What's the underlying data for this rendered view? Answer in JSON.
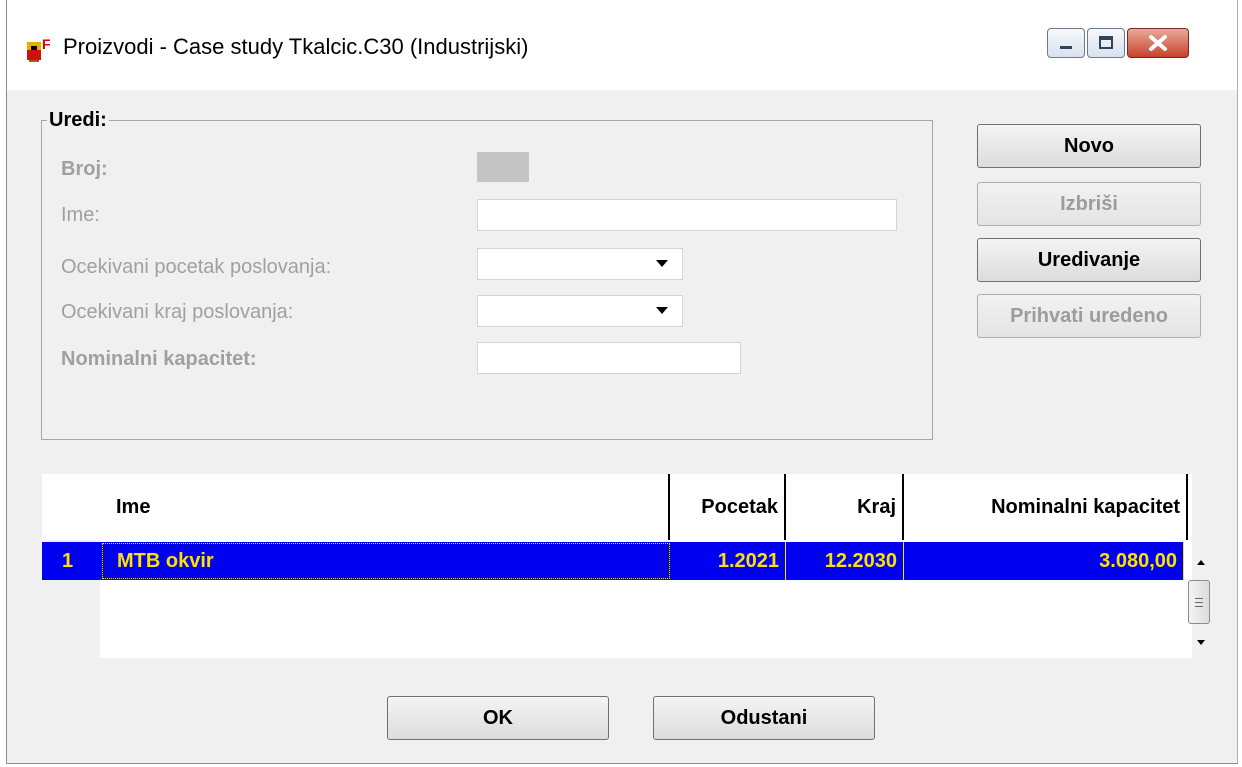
{
  "window": {
    "title": "Proizvodi - Case study Tkalcic.C30 (Industrijski)",
    "app_icon": "app-logo-icon",
    "controls": [
      "minimize-icon",
      "maximize-icon",
      "close-icon"
    ]
  },
  "form": {
    "group_label": "Uredi:",
    "fields": {
      "broj": {
        "label": "Broj:",
        "value": ""
      },
      "ime": {
        "label": "Ime:",
        "value": ""
      },
      "pocetak": {
        "label": "Ocekivani pocetak poslovanja:",
        "value": ""
      },
      "kraj": {
        "label": "Ocekivani kraj poslovanja:",
        "value": ""
      },
      "kapacitet": {
        "label": "Nominalni kapacitet:",
        "value": ""
      }
    }
  },
  "actions": {
    "novo": "Novo",
    "izbrisi": "Izbriši",
    "uredivanje": "Uredivanje",
    "prihvati": "Prihvati uredeno"
  },
  "table": {
    "columns": [
      "Ime",
      "Pocetak",
      "Kraj",
      "Nominalni kapacitet"
    ],
    "rows": [
      {
        "num": "1",
        "ime": "MTB okvir",
        "pocetak": "1.2021",
        "kraj": "12.2030",
        "kapacitet": "3.080,00"
      }
    ]
  },
  "footer": {
    "ok": "OK",
    "cancel": "Odustani"
  },
  "colors": {
    "selection_bg": "#0000f0",
    "selection_text": "#ffe000",
    "window_bg": "#f0f0f0"
  }
}
